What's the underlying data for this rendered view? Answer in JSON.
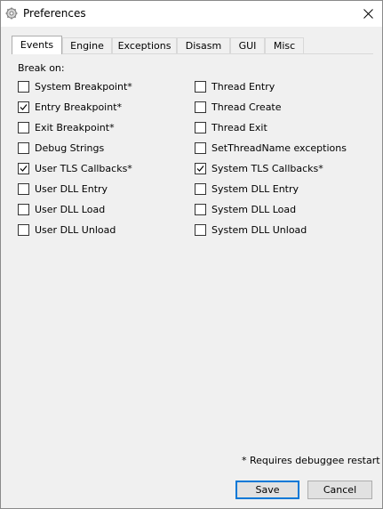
{
  "window": {
    "title": "Preferences",
    "icon": "gear-icon",
    "close_icon": "close-icon"
  },
  "tabs": [
    {
      "label": "Events",
      "active": true
    },
    {
      "label": "Engine",
      "active": false
    },
    {
      "label": "Exceptions",
      "active": false
    },
    {
      "label": "Disasm",
      "active": false
    },
    {
      "label": "GUI",
      "active": false
    },
    {
      "label": "Misc",
      "active": false
    }
  ],
  "events": {
    "heading": "Break on:",
    "left": [
      {
        "label": "System Breakpoint*",
        "checked": false
      },
      {
        "label": "Entry Breakpoint*",
        "checked": true
      },
      {
        "label": "Exit Breakpoint*",
        "checked": false
      },
      {
        "label": "Debug Strings",
        "checked": false
      },
      {
        "label": "User TLS Callbacks*",
        "checked": true
      },
      {
        "label": "User DLL Entry",
        "checked": false
      },
      {
        "label": "User DLL Load",
        "checked": false
      },
      {
        "label": "User DLL Unload",
        "checked": false
      }
    ],
    "right": [
      {
        "label": "Thread Entry",
        "checked": false
      },
      {
        "label": "Thread Create",
        "checked": false
      },
      {
        "label": "Thread Exit",
        "checked": false
      },
      {
        "label": "SetThreadName exceptions",
        "checked": false
      },
      {
        "label": "System TLS Callbacks*",
        "checked": true
      },
      {
        "label": "System DLL Entry",
        "checked": false
      },
      {
        "label": "System DLL Load",
        "checked": false
      },
      {
        "label": "System DLL Unload",
        "checked": false
      }
    ]
  },
  "footnote": "* Requires debuggee restart",
  "buttons": {
    "save": "Save",
    "cancel": "Cancel"
  },
  "colors": {
    "accent": "#0078d7"
  }
}
